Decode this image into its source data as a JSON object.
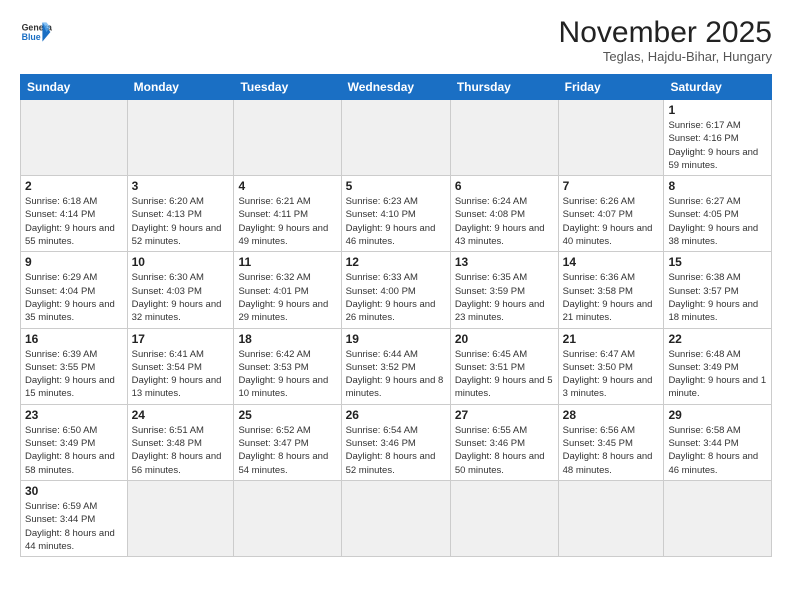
{
  "logo": {
    "text_general": "General",
    "text_blue": "Blue"
  },
  "title": "November 2025",
  "subtitle": "Teglas, Hajdu-Bihar, Hungary",
  "days_of_week": [
    "Sunday",
    "Monday",
    "Tuesday",
    "Wednesday",
    "Thursday",
    "Friday",
    "Saturday"
  ],
  "weeks": [
    [
      {
        "day": "",
        "empty": true
      },
      {
        "day": "",
        "empty": true
      },
      {
        "day": "",
        "empty": true
      },
      {
        "day": "",
        "empty": true
      },
      {
        "day": "",
        "empty": true
      },
      {
        "day": "",
        "empty": true
      },
      {
        "day": "1",
        "sunrise": "6:17 AM",
        "sunset": "4:16 PM",
        "daylight": "9 hours and 59 minutes."
      }
    ],
    [
      {
        "day": "2",
        "sunrise": "6:18 AM",
        "sunset": "4:14 PM",
        "daylight": "9 hours and 55 minutes."
      },
      {
        "day": "3",
        "sunrise": "6:20 AM",
        "sunset": "4:13 PM",
        "daylight": "9 hours and 52 minutes."
      },
      {
        "day": "4",
        "sunrise": "6:21 AM",
        "sunset": "4:11 PM",
        "daylight": "9 hours and 49 minutes."
      },
      {
        "day": "5",
        "sunrise": "6:23 AM",
        "sunset": "4:10 PM",
        "daylight": "9 hours and 46 minutes."
      },
      {
        "day": "6",
        "sunrise": "6:24 AM",
        "sunset": "4:08 PM",
        "daylight": "9 hours and 43 minutes."
      },
      {
        "day": "7",
        "sunrise": "6:26 AM",
        "sunset": "4:07 PM",
        "daylight": "9 hours and 40 minutes."
      },
      {
        "day": "8",
        "sunrise": "6:27 AM",
        "sunset": "4:05 PM",
        "daylight": "9 hours and 38 minutes."
      }
    ],
    [
      {
        "day": "9",
        "sunrise": "6:29 AM",
        "sunset": "4:04 PM",
        "daylight": "9 hours and 35 minutes."
      },
      {
        "day": "10",
        "sunrise": "6:30 AM",
        "sunset": "4:03 PM",
        "daylight": "9 hours and 32 minutes."
      },
      {
        "day": "11",
        "sunrise": "6:32 AM",
        "sunset": "4:01 PM",
        "daylight": "9 hours and 29 minutes."
      },
      {
        "day": "12",
        "sunrise": "6:33 AM",
        "sunset": "4:00 PM",
        "daylight": "9 hours and 26 minutes."
      },
      {
        "day": "13",
        "sunrise": "6:35 AM",
        "sunset": "3:59 PM",
        "daylight": "9 hours and 23 minutes."
      },
      {
        "day": "14",
        "sunrise": "6:36 AM",
        "sunset": "3:58 PM",
        "daylight": "9 hours and 21 minutes."
      },
      {
        "day": "15",
        "sunrise": "6:38 AM",
        "sunset": "3:57 PM",
        "daylight": "9 hours and 18 minutes."
      }
    ],
    [
      {
        "day": "16",
        "sunrise": "6:39 AM",
        "sunset": "3:55 PM",
        "daylight": "9 hours and 15 minutes."
      },
      {
        "day": "17",
        "sunrise": "6:41 AM",
        "sunset": "3:54 PM",
        "daylight": "9 hours and 13 minutes."
      },
      {
        "day": "18",
        "sunrise": "6:42 AM",
        "sunset": "3:53 PM",
        "daylight": "9 hours and 10 minutes."
      },
      {
        "day": "19",
        "sunrise": "6:44 AM",
        "sunset": "3:52 PM",
        "daylight": "9 hours and 8 minutes."
      },
      {
        "day": "20",
        "sunrise": "6:45 AM",
        "sunset": "3:51 PM",
        "daylight": "9 hours and 5 minutes."
      },
      {
        "day": "21",
        "sunrise": "6:47 AM",
        "sunset": "3:50 PM",
        "daylight": "9 hours and 3 minutes."
      },
      {
        "day": "22",
        "sunrise": "6:48 AM",
        "sunset": "3:49 PM",
        "daylight": "9 hours and 1 minute."
      }
    ],
    [
      {
        "day": "23",
        "sunrise": "6:50 AM",
        "sunset": "3:49 PM",
        "daylight": "8 hours and 58 minutes."
      },
      {
        "day": "24",
        "sunrise": "6:51 AM",
        "sunset": "3:48 PM",
        "daylight": "8 hours and 56 minutes."
      },
      {
        "day": "25",
        "sunrise": "6:52 AM",
        "sunset": "3:47 PM",
        "daylight": "8 hours and 54 minutes."
      },
      {
        "day": "26",
        "sunrise": "6:54 AM",
        "sunset": "3:46 PM",
        "daylight": "8 hours and 52 minutes."
      },
      {
        "day": "27",
        "sunrise": "6:55 AM",
        "sunset": "3:46 PM",
        "daylight": "8 hours and 50 minutes."
      },
      {
        "day": "28",
        "sunrise": "6:56 AM",
        "sunset": "3:45 PM",
        "daylight": "8 hours and 48 minutes."
      },
      {
        "day": "29",
        "sunrise": "6:58 AM",
        "sunset": "3:44 PM",
        "daylight": "8 hours and 46 minutes."
      }
    ],
    [
      {
        "day": "30",
        "sunrise": "6:59 AM",
        "sunset": "3:44 PM",
        "daylight": "8 hours and 44 minutes."
      },
      {
        "day": "",
        "empty": true
      },
      {
        "day": "",
        "empty": true
      },
      {
        "day": "",
        "empty": true
      },
      {
        "day": "",
        "empty": true
      },
      {
        "day": "",
        "empty": true
      },
      {
        "day": "",
        "empty": true
      }
    ]
  ]
}
